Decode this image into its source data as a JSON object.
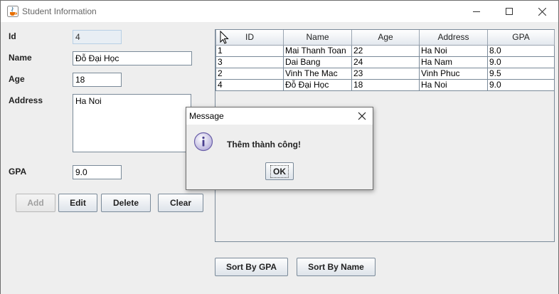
{
  "window": {
    "title": "Student Information",
    "icon": "java-cup-icon"
  },
  "form": {
    "id_label": "Id",
    "id_value": "4",
    "name_label": "Name",
    "name_value": "Đỗ Đại Học",
    "age_label": "Age",
    "age_value": "18",
    "address_label": "Address",
    "address_value": "Ha Noi",
    "gpa_label": "GPA",
    "gpa_value": "9.0"
  },
  "buttons": {
    "add": "Add",
    "edit": "Edit",
    "delete": "Delete",
    "clear": "Clear",
    "sort_gpa": "Sort By GPA",
    "sort_name": "Sort By Name"
  },
  "table": {
    "columns": [
      "ID",
      "Name",
      "Age",
      "Address",
      "GPA"
    ],
    "rows": [
      [
        "1",
        "Mai Thanh Toan",
        "22",
        "Ha Noi",
        "8.0"
      ],
      [
        "3",
        "Dai Bang",
        "24",
        "Ha Nam",
        "9.0"
      ],
      [
        "2",
        "Vinh The Mac",
        "23",
        "Vinh Phuc",
        "9.5"
      ],
      [
        "4",
        "Đỗ Đại Học",
        "18",
        "Ha Noi",
        "9.0"
      ]
    ]
  },
  "dialog": {
    "title": "Message",
    "message": "Thêm thành công!",
    "ok_label": "OK",
    "icon": "info-icon"
  }
}
